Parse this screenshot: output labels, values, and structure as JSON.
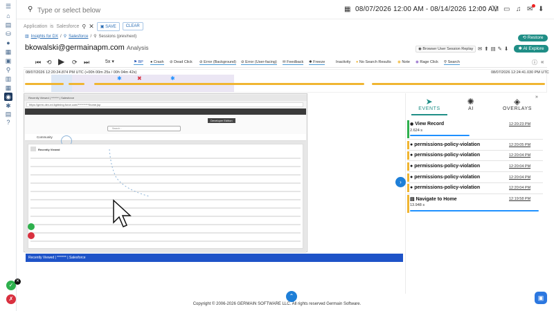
{
  "search": {
    "placeholder": "Type or select below"
  },
  "date_range": {
    "text": "08/07/2026 12:00 AM - 08/14/2026 12:00 AM",
    "tz": "UTC"
  },
  "filter": {
    "field": "Application",
    "op": "is",
    "value": "Salesforce",
    "save_label": "SAVE",
    "clear_label": "CLEAR"
  },
  "breadcrumbs": [
    "Insights for DX",
    "Salesforce",
    "Sessions (prev/next)"
  ],
  "restore_label": "Restore",
  "user": {
    "email": "bkowalski@germainapm.com",
    "suffix": "Analysis"
  },
  "replay_label": "Browser User Session Replay",
  "ai_explore_label": "AI Explore",
  "player": {
    "speed": "5x"
  },
  "event_filters": [
    "BP",
    "Crash",
    "Dead Click",
    "Error (Background)",
    "Error (User-facing)",
    "Feedback",
    "Freeze",
    "Inactivity",
    "No Search Results",
    "Note",
    "Rage Click",
    "Search"
  ],
  "timeline": {
    "start": "08/07/2026 12:20:24.874 PM UTC (+00h 00m 25s / 00h 04m 42s)",
    "end": "08/07/2026 12:24:41.030 PM UTC"
  },
  "viewport": {
    "tab": "Recently Viewed | ******* | Salesforce",
    "url": "https://germ-dev-ed.lightning.force.com/**********/home.jsp",
    "banner": "Developer Edition",
    "app": "Community",
    "card_title": "Recently Viewed",
    "search_ph": "Search..."
  },
  "bottom_tab": "Recently Viewed | ******* | Salesforce",
  "panel_tabs": [
    "EVENTS",
    "AI",
    "OVERLAYS"
  ],
  "events": [
    {
      "title": "View Record",
      "time": "12:20:23 PM",
      "sub": "2.624 s"
    },
    {
      "title": "permissions-policy-violation",
      "time": "12:20:05 PM",
      "sub": ""
    },
    {
      "title": "permissions-policy-violation",
      "time": "12:20:04 PM",
      "sub": ""
    },
    {
      "title": "permissions-policy-violation",
      "time": "12:20:04 PM",
      "sub": ""
    },
    {
      "title": "permissions-policy-violation",
      "time": "12:20:04 PM",
      "sub": ""
    },
    {
      "title": "permissions-policy-violation",
      "time": "12:20:04 PM",
      "sub": ""
    },
    {
      "title": "Navigate to Home",
      "time": "12:19:58 PM",
      "sub": "13.948 s"
    }
  ],
  "copyright": "Copyright © 2006-2026 GERMAIN SOFTWARE LLC. All rights reserved Germain Software."
}
